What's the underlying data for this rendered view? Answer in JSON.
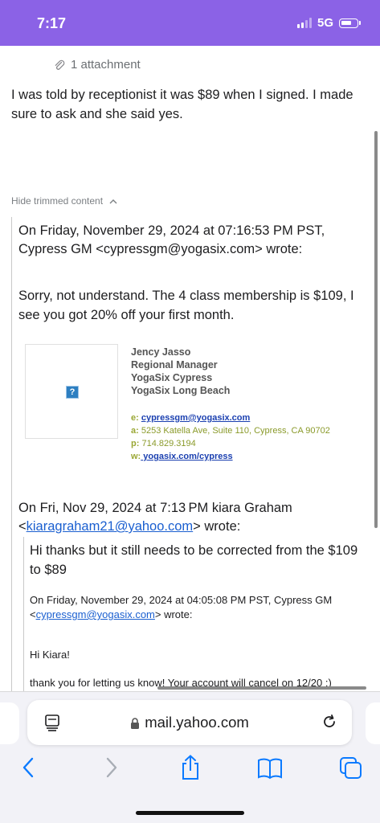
{
  "status": {
    "time": "7:17",
    "network": "5G"
  },
  "email": {
    "attachment": "1 attachment",
    "body": "I was told by receptionist it was $89 when I signed. I made sure to ask and she said yes.",
    "hide_trimmed": "Hide trimmed content",
    "quote1": {
      "header": "On Friday, November 29, 2024 at 07:16:53 PM PST, Cypress GM <cypressgm@yogasix.com> wrote:",
      "message": "Sorry, not understand. The 4 class membership is $109, I see you got 20% off your first month.",
      "signature": {
        "name": "Jency Jasso",
        "title": "Regional Manager",
        "studio1": "YogaSix Cypress",
        "studio2": "YogaSix Long Beach",
        "email_label": "e:",
        "email": "cypressgm@yogasix.com",
        "address_label": "a:",
        "address": "5253 Katella Ave, Suite 110, Cypress, CA 90702",
        "phone_label": "p:",
        "phone": "714.829.3194",
        "web_label": "w:",
        "web": " yogasix.com/cypress"
      }
    },
    "quote2": {
      "header_prefix": "On Fri, Nov 29, 2024 at 7:13 PM kiara Graham <",
      "header_email": "kiaragraham21@yahoo.com",
      "header_suffix": "> wrote:",
      "message": "Hi thanks but it still needs to be corrected from the $109 to $89"
    },
    "quote3": {
      "header_prefix": "On Friday, November 29, 2024 at 04:05:08 PM PST, Cypress GM <",
      "header_email": "cypressgm@yogasix.com",
      "header_suffix": "> wrote:",
      "greeting": "Hi Kiara!",
      "thanks": "thank you for letting us know! Your account will cancel on 12/20 :)"
    }
  },
  "browser": {
    "url": "mail.yahoo.com"
  },
  "colors": {
    "status_bar": "#8b62e6",
    "ios_blue": "#0a7aff",
    "link": "#1a5fd0"
  }
}
